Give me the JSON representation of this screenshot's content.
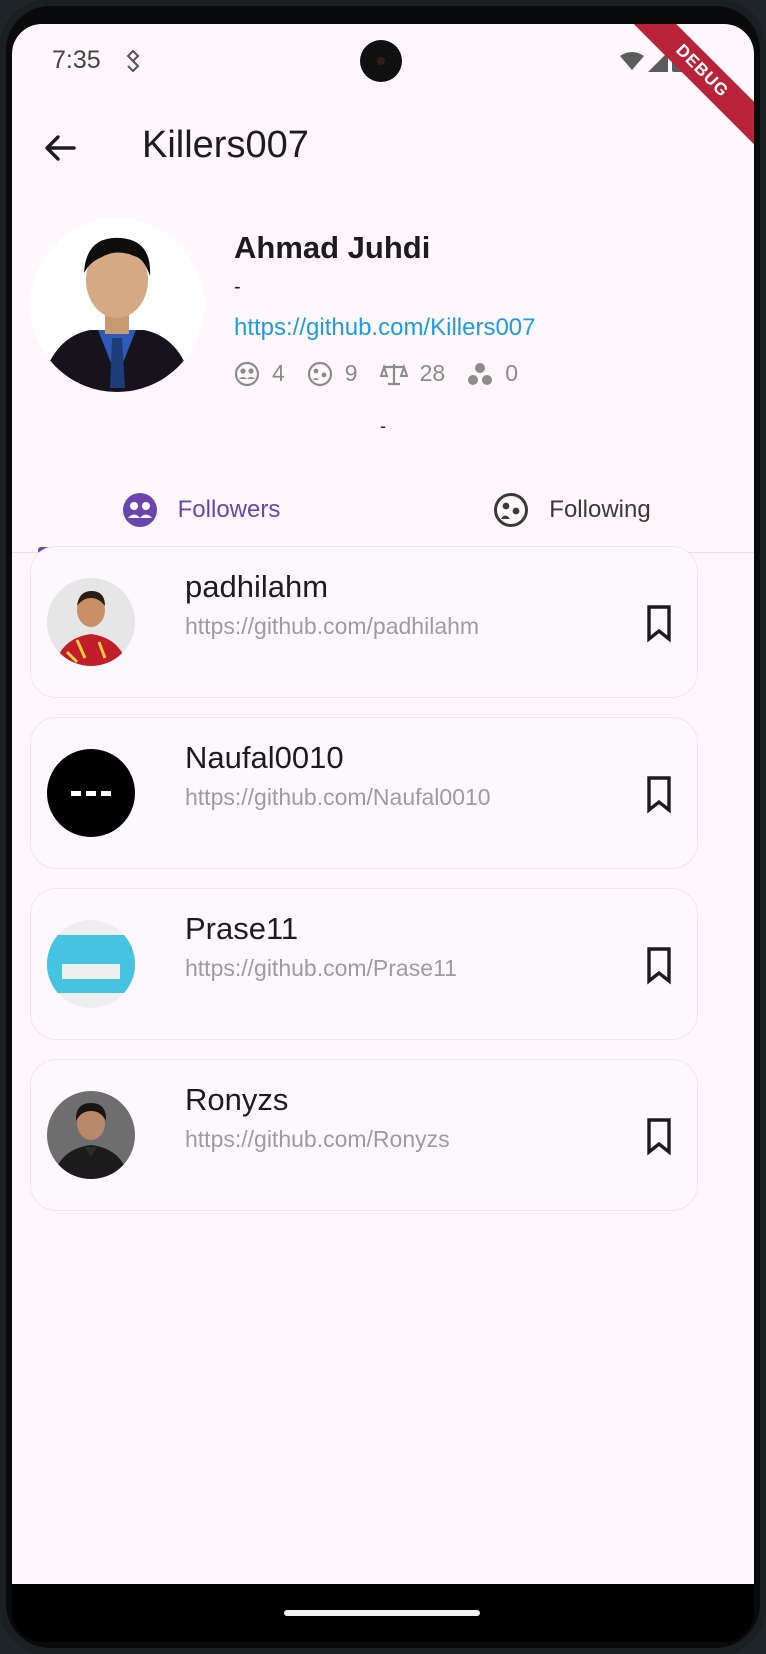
{
  "status_bar": {
    "time": "7:35",
    "debug_label": "DEBUG"
  },
  "app_bar": {
    "title": "Killers007"
  },
  "profile": {
    "name": "Ahmad Juhdi",
    "bio": "-",
    "url": "https://github.com/Killers007",
    "location": "-",
    "stats": [
      {
        "icon": "followers-icon",
        "value": "4"
      },
      {
        "icon": "following-icon",
        "value": "9"
      },
      {
        "icon": "repositories-scale-icon",
        "value": "28"
      },
      {
        "icon": "gists-icon",
        "value": "0"
      }
    ]
  },
  "tabs": [
    {
      "label": "Followers",
      "icon": "followers-icon",
      "selected": true
    },
    {
      "label": "Following",
      "icon": "following-icon",
      "selected": false
    }
  ],
  "users": [
    {
      "login": "padhilahm",
      "url": "https://github.com/padhilahm"
    },
    {
      "login": "Naufal0010",
      "url": "https://github.com/Naufal0010"
    },
    {
      "login": "Prase11",
      "url": "https://github.com/Prase11"
    },
    {
      "login": "Ronyzs",
      "url": "https://github.com/Ronyzs"
    }
  ],
  "colors": {
    "accent": "#6a45b0",
    "link": "#1e9be8",
    "background": "#fef7fb"
  }
}
